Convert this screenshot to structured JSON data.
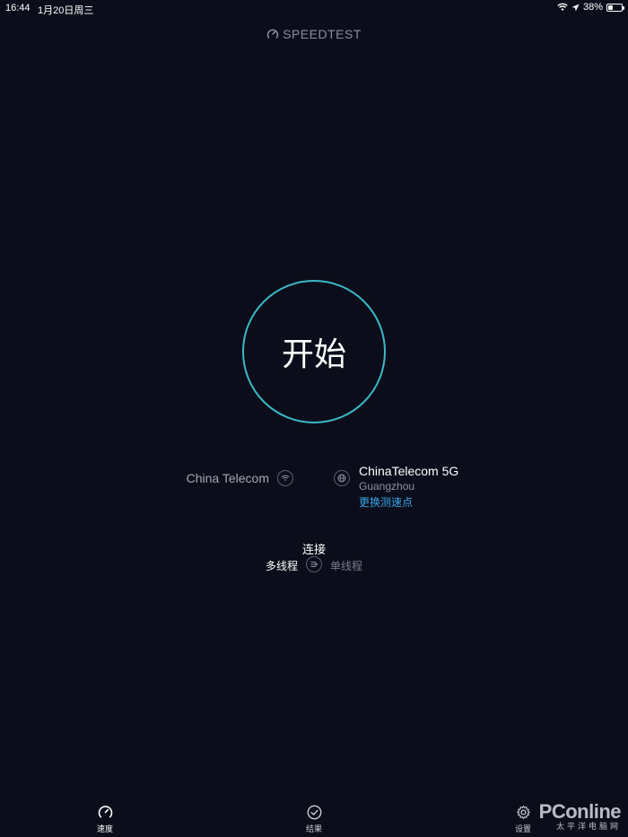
{
  "status_bar": {
    "time": "16:44",
    "date": "1月20日周三",
    "battery_percent": "38%",
    "battery_level": 0.38
  },
  "app": {
    "logo_text": "SPEEDTEST"
  },
  "start_button": {
    "label": "开始"
  },
  "connection": {
    "isp_name": "China Telecom",
    "server_name": "ChinaTelecom 5G",
    "server_city": "Guangzhou",
    "change_server_label": "更换测速点"
  },
  "connections_mode": {
    "title": "连接",
    "multi_label": "多线程",
    "single_label": "单线程",
    "selected": "multi"
  },
  "tabs": [
    {
      "label": "速度",
      "icon": "speedometer-icon",
      "active": true
    },
    {
      "label": "结果",
      "icon": "check-circle-icon",
      "active": false
    },
    {
      "label": "设置",
      "icon": "gear-icon",
      "active": false
    }
  ],
  "watermark": {
    "main": "PConline",
    "sub": "太平洋电脑网"
  },
  "colors": {
    "background": "#0b0e1a",
    "ring": "#3bb8c9",
    "link": "#3aa3e8"
  }
}
